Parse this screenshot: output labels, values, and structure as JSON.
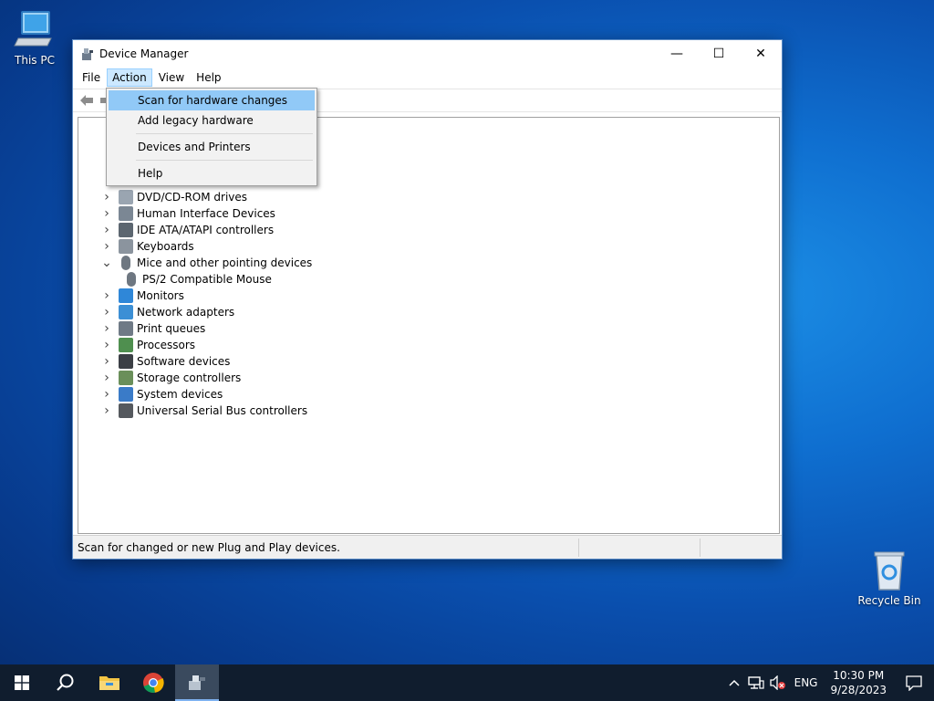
{
  "desktop": {
    "this_pc_label": "This PC",
    "recycle_bin_label": "Recycle Bin"
  },
  "window": {
    "title": "Device Manager",
    "minimize": "—",
    "maximize": "☐",
    "close": "✕"
  },
  "menubar": {
    "file": "File",
    "action": "Action",
    "view": "View",
    "help": "Help"
  },
  "action_menu": {
    "items": [
      {
        "label": "Scan for hardware changes",
        "highlighted": true
      },
      {
        "label": "Add legacy hardware"
      },
      {
        "label": "Devices and Printers"
      },
      {
        "label": "Help"
      }
    ]
  },
  "tree": {
    "items": [
      {
        "label": "DVD/CD-ROM drives",
        "expanded": false,
        "icon": "dvd-drive-icon"
      },
      {
        "label": "Human Interface Devices",
        "expanded": false,
        "icon": "hid-icon"
      },
      {
        "label": "IDE ATA/ATAPI controllers",
        "expanded": false,
        "icon": "ide-controller-icon"
      },
      {
        "label": "Keyboards",
        "expanded": false,
        "icon": "keyboard-icon"
      },
      {
        "label": "Mice and other pointing devices",
        "expanded": true,
        "icon": "mouse-icon"
      },
      {
        "label": "PS/2 Compatible Mouse",
        "child": true,
        "icon": "mouse-icon"
      },
      {
        "label": "Monitors",
        "expanded": false,
        "icon": "monitor-icon"
      },
      {
        "label": "Network adapters",
        "expanded": false,
        "icon": "network-adapter-icon"
      },
      {
        "label": "Print queues",
        "expanded": false,
        "icon": "printer-icon"
      },
      {
        "label": "Processors",
        "expanded": false,
        "icon": "processor-icon"
      },
      {
        "label": "Software devices",
        "expanded": false,
        "icon": "software-device-icon"
      },
      {
        "label": "Storage controllers",
        "expanded": false,
        "icon": "storage-controller-icon"
      },
      {
        "label": "System devices",
        "expanded": false,
        "icon": "system-device-icon"
      },
      {
        "label": "Universal Serial Bus controllers",
        "expanded": false,
        "icon": "usb-icon"
      }
    ]
  },
  "status": {
    "text": "Scan for changed or new Plug and Play devices."
  },
  "taskbar": {
    "language": "ENG",
    "time": "10:30 PM",
    "date": "9/28/2023"
  },
  "colors": {
    "menu_highlight": "#91c9f7",
    "active_menu_bg": "#cce8ff",
    "taskbar_bg": "#101d2e"
  }
}
